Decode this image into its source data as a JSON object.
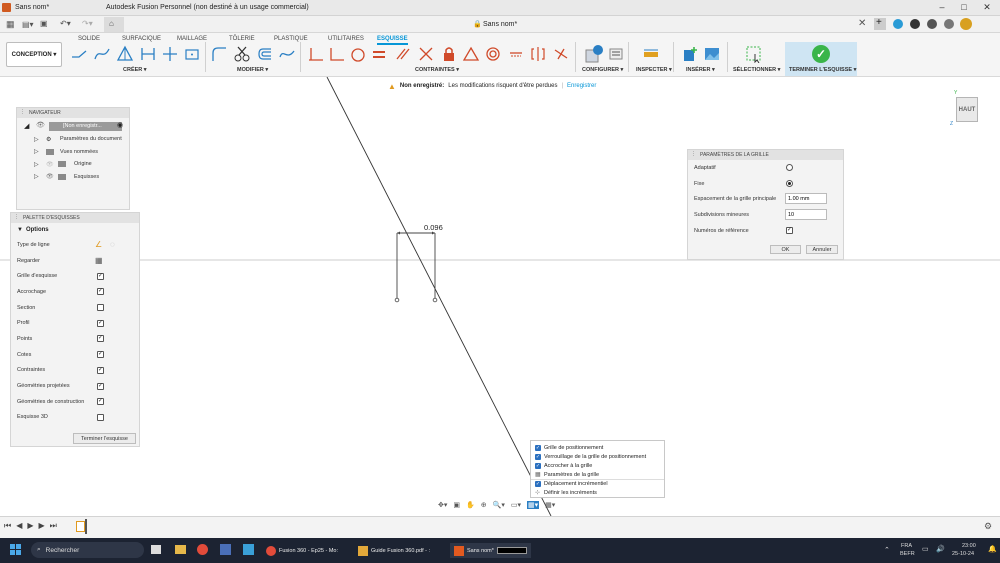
{
  "window": {
    "tab_title": "Sans nom*",
    "app_title": "Autodesk Fusion Personnel (non destiné à un usage commercial)",
    "doc_title": "Sans nom*"
  },
  "ribbon": {
    "tabs": [
      {
        "label": "SOLIDE"
      },
      {
        "label": "SURFACIQUE"
      },
      {
        "label": "MAILLAGE"
      },
      {
        "label": "TÔLERIE"
      },
      {
        "label": "PLASTIQUE"
      },
      {
        "label": "UTILITAIRES"
      },
      {
        "label": "ESQUISSE"
      }
    ],
    "workspace": "CONCEPTION ▾",
    "groups": {
      "create": "CRÉER ▾",
      "modify": "MODIFIER ▾",
      "constraints": "CONTRAINTES ▾",
      "configure": "CONFIGURER ▾",
      "inspect": "INSPECTER ▾",
      "insert": "INSÉRER ▾",
      "select": "SÉLECTIONNER ▾",
      "finish": "TERMINER L'ESQUISSE ▾"
    }
  },
  "warning": {
    "bold": "Non enregistré:",
    "text": "Les modifications risquent d'être perdues",
    "link": "Enregistrer"
  },
  "viewcube": {
    "label": "HAUT"
  },
  "navigator": {
    "title": "NAVIGATEUR",
    "root": "[Non enregistr...",
    "items": [
      {
        "label": "Paramètres du document"
      },
      {
        "label": "Vues nommées"
      },
      {
        "label": "Origine"
      },
      {
        "label": "Esquisses"
      }
    ]
  },
  "palette": {
    "title": "PALETTE D'ESQUISSES",
    "section": "Options",
    "rows": [
      {
        "label": "Type de ligne",
        "type": "linetype"
      },
      {
        "label": "Regarder",
        "type": "look"
      },
      {
        "label": "Grille d'esquisse",
        "checked": true
      },
      {
        "label": "Accrochage",
        "checked": true
      },
      {
        "label": "Section",
        "checked": false
      },
      {
        "label": "Profil",
        "checked": true
      },
      {
        "label": "Points",
        "checked": true
      },
      {
        "label": "Cotes",
        "checked": true
      },
      {
        "label": "Contraintes",
        "checked": true
      },
      {
        "label": "Géométries projetées",
        "checked": true
      },
      {
        "label": "Géométries de construction",
        "checked": true
      },
      {
        "label": "Esquisse 3D",
        "checked": false
      }
    ],
    "finish": "Terminer l'esquisse"
  },
  "grid_dialog": {
    "title": "PARAMÈTRES DE LA GRILLE",
    "adaptive": "Adaptatif",
    "fixed": "Fixe",
    "spacing_label": "Espacement de la grille principale",
    "spacing": "1.00 mm",
    "minor_label": "Subdivisions mineures",
    "minor": "10",
    "ref_label": "Numéros de référence",
    "ok": "OK",
    "cancel": "Annuler"
  },
  "dimension": {
    "value": "0.096"
  },
  "grid_menu": {
    "items": [
      {
        "label": "Grille de positionnement",
        "checked": true
      },
      {
        "label": "Verrouillage de la grille de positionnement",
        "checked": true
      },
      {
        "label": "Accrocher à la grille",
        "checked": true
      },
      {
        "label": "Paramètres de la grille",
        "checked": false
      },
      {
        "label": "Déplacement incrémentiel",
        "checked": true
      },
      {
        "label": "Définir les incréments",
        "checked": false
      }
    ]
  },
  "taskbar": {
    "search": "Rechercher",
    "app1": "Fusion 360 - Ep25 - Mo:",
    "app2": "Guide Fusion 360.pdf - :",
    "app3": "Sans nom*",
    "lang1": "FRA",
    "lang2": "BEFR",
    "time": "23:00",
    "date": "25-10-24"
  },
  "colors": {
    "accent": "#0696d7",
    "finish": "#3ab54a",
    "taskbar": "#1c2332"
  }
}
